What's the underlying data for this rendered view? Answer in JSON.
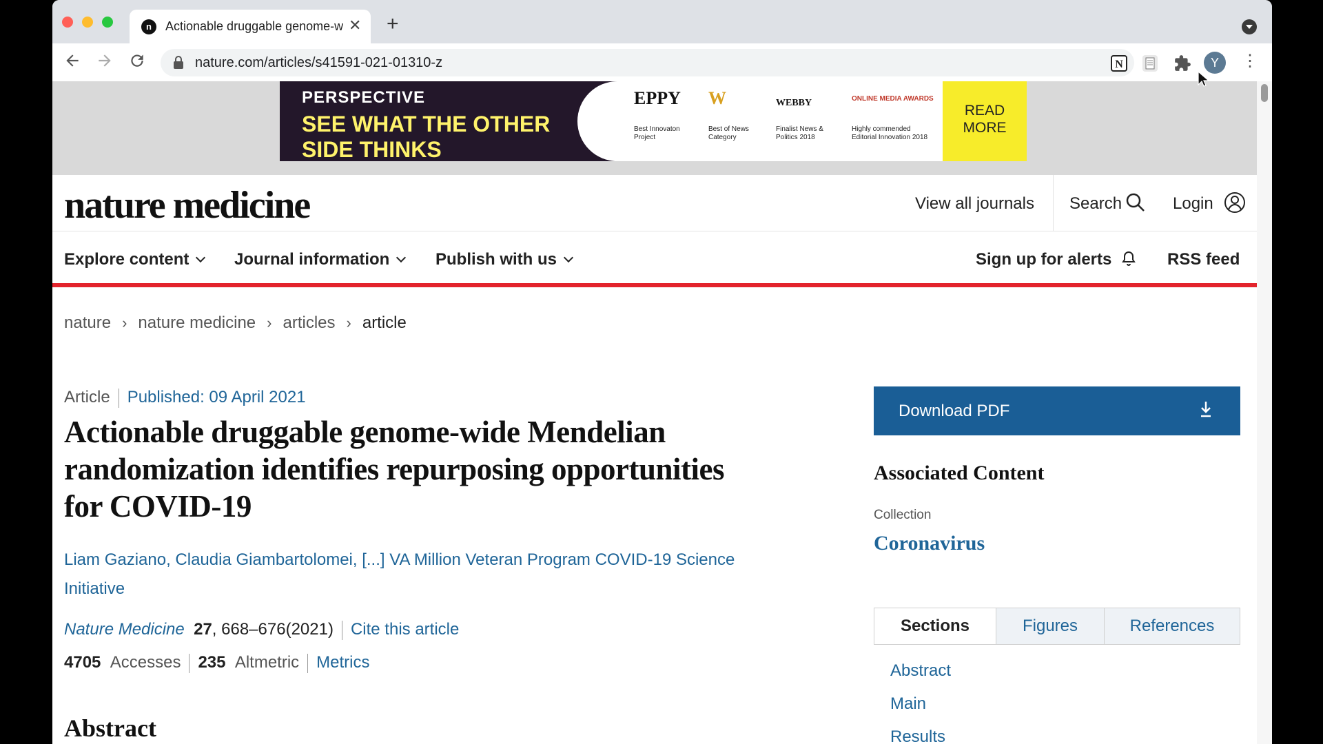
{
  "browser": {
    "tab_title": "Actionable druggable genome-wide Mendelian randomization",
    "tab_favicon": "n",
    "url": "nature.com/articles/s41591-021-01310-z",
    "profile_initial": "Y"
  },
  "ad": {
    "brand": "PERSPECTIVE",
    "headline": "SEE WHAT THE OTHER SIDE THINKS",
    "awards": [
      {
        "logo": "EPPY",
        "caption": "Best Innovaton Project"
      },
      {
        "logo": "W",
        "caption": "Best of News Category"
      },
      {
        "logo": "WEBBY",
        "caption": "Finalist News & Politics 2018"
      },
      {
        "logo": "ONLINE MEDIA AWARDS",
        "caption": "Highly commended Editorial Innovation 2018"
      }
    ],
    "cta": "READ MORE"
  },
  "header": {
    "logo": "nature medicine",
    "view_all": "View all journals",
    "search": "Search",
    "login": "Login"
  },
  "nav": {
    "explore": "Explore content",
    "journal_info": "Journal information",
    "publish": "Publish with us",
    "alerts": "Sign up for alerts",
    "rss": "RSS feed"
  },
  "breadcrumb": [
    "nature",
    "nature medicine",
    "articles",
    "article"
  ],
  "article": {
    "type": "Article",
    "published": "Published: 09 April 2021",
    "title": "Actionable druggable genome-wide Mendelian randomization identifies repurposing opportunities for COVID-19",
    "authors": [
      "Liam Gaziano",
      "Claudia Giambartolomei",
      "[...]",
      "VA Million Veteran Program COVID-19 Science Initiative"
    ],
    "journal": "Nature Medicine",
    "volume": "27",
    "pages": ", 668–676",
    "year": "(2021)",
    "cite": "Cite this article",
    "accesses_count": "4705",
    "accesses_label": "Accesses",
    "altmetric_count": "235",
    "altmetric_label": "Altmetric",
    "metrics": "Metrics",
    "abstract_heading": "Abstract"
  },
  "sidebar": {
    "download": "Download PDF",
    "associated_heading": "Associated Content",
    "collection_label": "Collection",
    "collection_link": "Coronavirus",
    "tabs": [
      "Sections",
      "Figures",
      "References"
    ],
    "sections": [
      "Abstract",
      "Main",
      "Results"
    ]
  },
  "colors": {
    "link": "#1f6598",
    "download_bg": "#1a5e96",
    "nav_underline": "#e3232c",
    "ad_bg": "#23172a",
    "ad_headline": "#fff36b",
    "ad_cta_bg": "#f7ec2a"
  }
}
